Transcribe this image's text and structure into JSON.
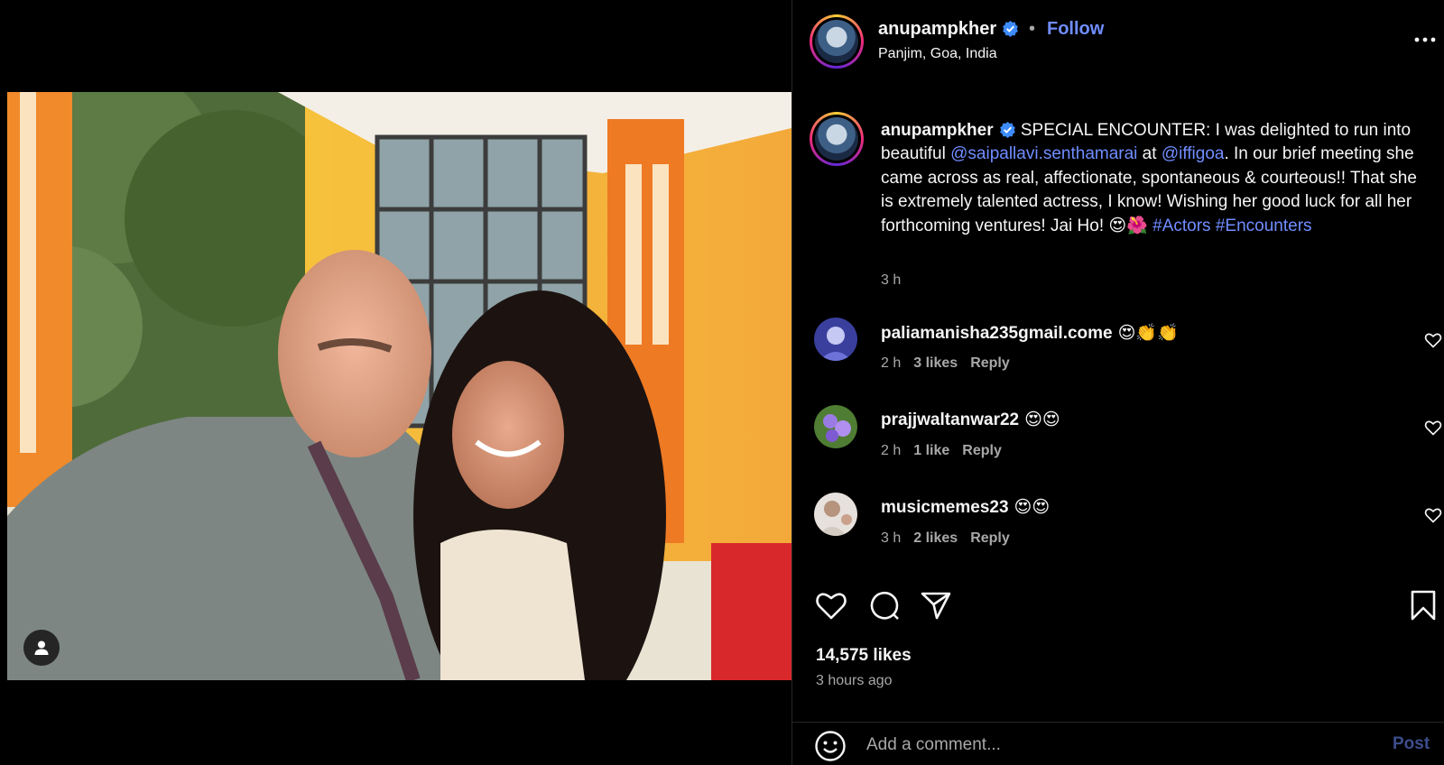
{
  "post": {
    "username": "anupampkher",
    "follow_label": "Follow",
    "separator": "•",
    "location": "Panjim, Goa, India",
    "more_icon": "more-horizontal-icon"
  },
  "caption": {
    "username": "anupampkher",
    "text_1": " SPECIAL ENCOUNTER: I was delighted to run into beautiful ",
    "mention_1": "@saipallavi.senthamarai",
    "text_2": " at ",
    "mention_2": "@iffigoa",
    "text_3": ". In our brief meeting she came across as real, affectionate, spontaneous & courteous!! That she is extremely talented actress, I know! Wishing her good luck for all her forthcoming ventures! Jai Ho! ",
    "emojis": "😍🌺 ",
    "hashtag_1": "#Actors",
    "hashtag_2": "#Encounters",
    "time": "3 h"
  },
  "comments": [
    {
      "username": "paliamanisha235gmail.come",
      "text": "😍👏👏",
      "time": "2 h",
      "likes": "3 likes",
      "reply": "Reply"
    },
    {
      "username": "prajjwaltanwar22",
      "text": "😍😍",
      "time": "2 h",
      "likes": "1 like",
      "reply": "Reply"
    },
    {
      "username": "musicmemes23",
      "text": "😍😍",
      "time": "3 h",
      "likes": "2 likes",
      "reply": "Reply"
    }
  ],
  "actions": {
    "like_icon": "heart-icon",
    "comment_icon": "comment-icon",
    "share_icon": "share-icon",
    "save_icon": "bookmark-icon"
  },
  "stats": {
    "likes": "14,575 likes",
    "posted": "3 hours ago"
  },
  "comment_box": {
    "placeholder": "Add a comment...",
    "post_label": "Post"
  },
  "colors": {
    "accent": "#708dff",
    "secondary_text": "#a8a8a8",
    "background": "#000000"
  }
}
